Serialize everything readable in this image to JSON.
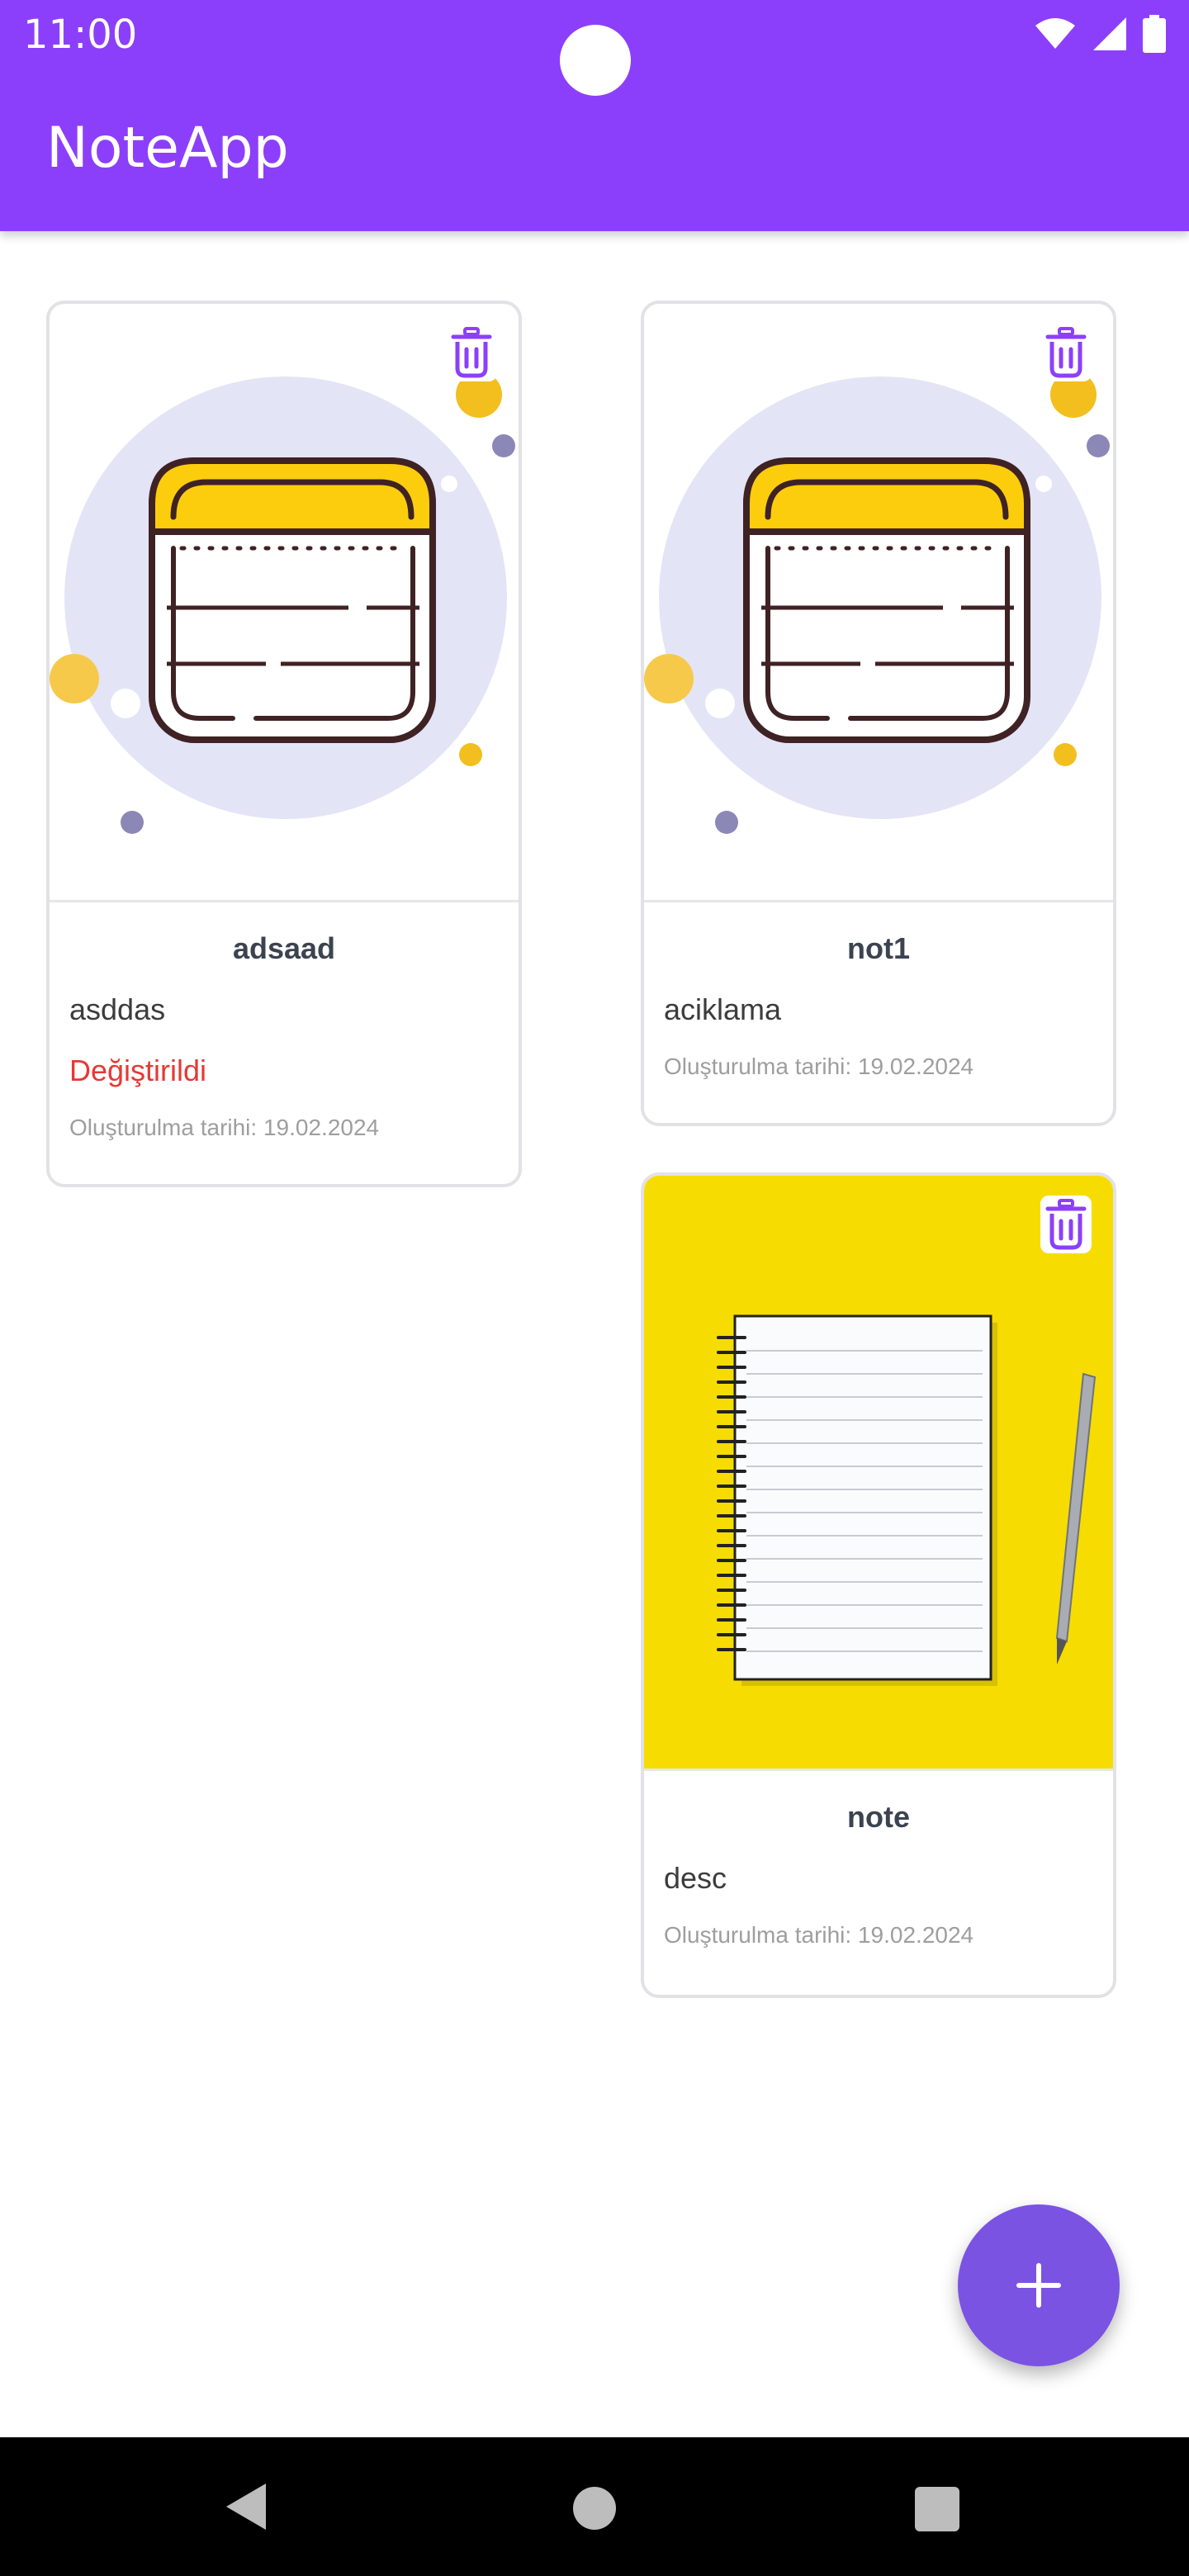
{
  "status_bar": {
    "time": "11:00"
  },
  "app_bar": {
    "title": "NoteApp"
  },
  "notes": [
    {
      "title": "adsaad",
      "description": "asddas",
      "modified": "Değiştirildi",
      "created": "Oluşturulma tarihi: 19.02.2024",
      "image": "notepad-illustration"
    },
    {
      "title": "not1",
      "description": "aciklama",
      "created": "Oluşturulma tarihi: 19.02.2024",
      "image": "notepad-illustration"
    },
    {
      "title": "note",
      "description": "desc",
      "created": "Oluşturulma tarihi: 19.02.2024",
      "image": "notebook-pen-photo"
    }
  ],
  "fab": {
    "icon": "plus-icon"
  },
  "colors": {
    "primary": "#8c3ffa",
    "fab": "#7b53e3",
    "modified": "#e53935",
    "trash": "#8c3ffa"
  }
}
